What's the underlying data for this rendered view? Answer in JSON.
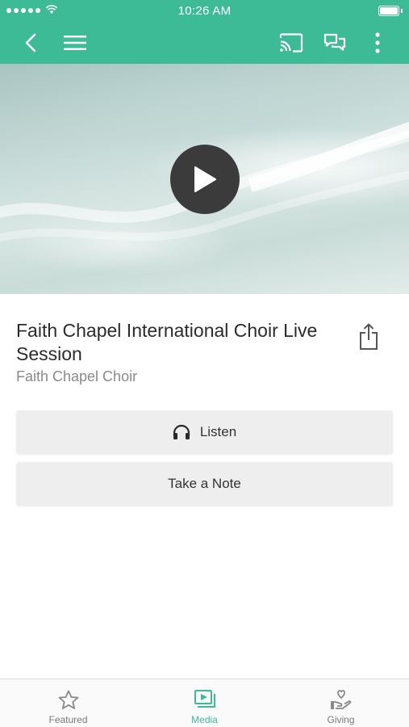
{
  "status_bar": {
    "time": "10:26 AM"
  },
  "nav": {
    "icons": [
      "chevron-left-icon",
      "menu-icon",
      "cast-icon",
      "chat-icon",
      "more-vertical-icon"
    ]
  },
  "media": {
    "title": "Faith Chapel International Choir Live Session",
    "author": "Faith Chapel Choir"
  },
  "actions": {
    "listen_label": "Listen",
    "note_label": "Take a Note"
  },
  "tabs": [
    {
      "label": "Featured",
      "icon": "star-icon",
      "active": false
    },
    {
      "label": "Media",
      "icon": "media-icon",
      "active": true
    },
    {
      "label": "Giving",
      "icon": "giving-icon",
      "active": false
    }
  ],
  "colors": {
    "brand": "#3dbb96",
    "button_bg": "#eeeeef"
  }
}
